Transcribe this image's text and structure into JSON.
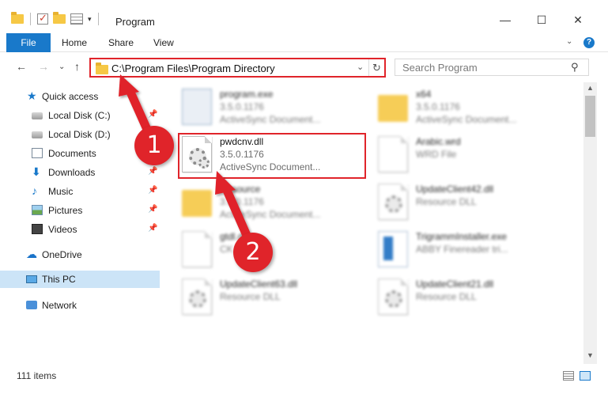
{
  "window": {
    "title": "Program",
    "minimize_icon": "minimize-icon",
    "maximize_icon": "maximize-icon",
    "close_icon": "close-icon"
  },
  "ribbon": {
    "tabs": [
      {
        "label": "File",
        "active": true
      },
      {
        "label": "Home"
      },
      {
        "label": "Share"
      },
      {
        "label": "View"
      }
    ],
    "help_label": "?"
  },
  "nav": {
    "address": "C:\\Program Files\\Program Directory",
    "search_placeholder": "Search Program"
  },
  "sidebar": {
    "items": [
      {
        "label": "Quick access",
        "icon": "star-icon"
      },
      {
        "label": "Local Disk (C:)",
        "icon": "disk-icon",
        "pinned": true
      },
      {
        "label": "Local Disk (D:)",
        "icon": "disk-icon",
        "pinned": true
      },
      {
        "label": "Documents",
        "icon": "documents-icon",
        "pinned": true
      },
      {
        "label": "Downloads",
        "icon": "download-icon",
        "pinned": true
      },
      {
        "label": "Music",
        "icon": "music-icon",
        "pinned": true
      },
      {
        "label": "Pictures",
        "icon": "pictures-icon",
        "pinned": true
      },
      {
        "label": "Videos",
        "icon": "video-icon",
        "pinned": true
      },
      {
        "label": "OneDrive",
        "icon": "cloud-icon"
      },
      {
        "label": "This PC",
        "icon": "pc-icon",
        "selected": true
      },
      {
        "label": "Network",
        "icon": "network-icon"
      }
    ]
  },
  "files": [
    {
      "name": "program.exe",
      "version": "3.5.0.1176",
      "desc": "ActiveSync Document...",
      "kind": "exe"
    },
    {
      "name": "x64",
      "version": "3.5.0.1176",
      "desc": "ActiveSync Document...",
      "kind": "folder"
    },
    {
      "name": "pwdcnv.dll",
      "version": "3.5.0.1176",
      "desc": "ActiveSync Document...",
      "kind": "dll",
      "highlighted": true
    },
    {
      "name": "Arabic.wrd",
      "version": "WRD File",
      "desc": "",
      "kind": "doc"
    },
    {
      "name": "Resource",
      "version": "3.5.0.1176",
      "desc": "ActiveSync Document...",
      "kind": "folder"
    },
    {
      "name": "UpdateClient42.dll",
      "version": "Resource DLL",
      "desc": "",
      "kind": "dll"
    },
    {
      "name": "gtdl.dll",
      "version": "CK",
      "desc": "",
      "kind": "doc"
    },
    {
      "name": "TrigrammInstaller.exe",
      "version": "ABBY Finereader tri...",
      "desc": "",
      "kind": "installer"
    },
    {
      "name": "UpdateClient63.dll",
      "version": "Resource DLL",
      "desc": "",
      "kind": "dll"
    },
    {
      "name": "UpdateClient21.dll",
      "version": "Resource DLL",
      "desc": "",
      "kind": "dll"
    }
  ],
  "status": {
    "items_count": "111 items"
  },
  "annotations": [
    {
      "label": "1"
    },
    {
      "label": "2"
    }
  ],
  "colors": {
    "accent": "#1979ca",
    "highlight_red": "#e0242a",
    "selected_bg": "#cce4f7"
  }
}
